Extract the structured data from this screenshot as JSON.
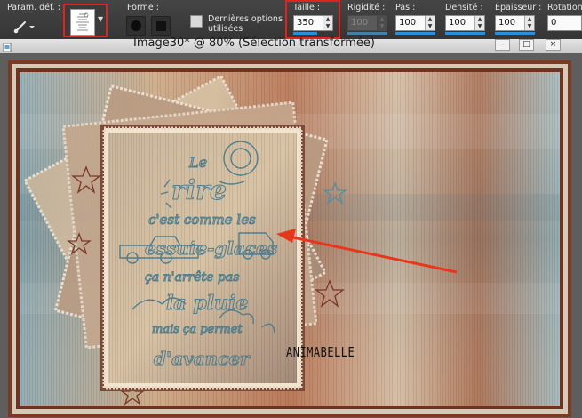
{
  "toolbar": {
    "preset_label": "Param. déf. :",
    "shape_label": "Forme :",
    "last_options_label": "Dernières options utilisées",
    "size": {
      "label": "Taille :",
      "value": "350"
    },
    "hardness": {
      "label": "Rigidité :",
      "value": "100"
    },
    "step": {
      "label": "Pas :",
      "value": "100"
    },
    "density": {
      "label": "Densité :",
      "value": "100"
    },
    "thickness": {
      "label": "Épaisseur :",
      "value": "100"
    },
    "rotation": {
      "label": "Rotation",
      "value": "0"
    }
  },
  "document": {
    "title": "Image30* @  80% (Sélection transformée)",
    "artwork_lines": [
      "Le",
      "rire",
      "c'est comme les",
      "essuie-glaces",
      "ça n'arrête pas",
      "la pluie",
      "mais ça permet",
      "d'avancer"
    ],
    "watermark": "ANIMABELLE"
  },
  "colors": {
    "highlight_box": "#e0231c",
    "arrow": "#e8361c",
    "toolbar_bg": "#3c3c3c",
    "spin_bar": "#2a8fd8"
  },
  "icons": [
    "brush-icon",
    "preset-thumbnail-icon",
    "dropdown-arrow-icon",
    "round-shape-icon",
    "square-shape-icon",
    "minimize-icon",
    "maximize-icon",
    "close-icon",
    "document-icon"
  ]
}
